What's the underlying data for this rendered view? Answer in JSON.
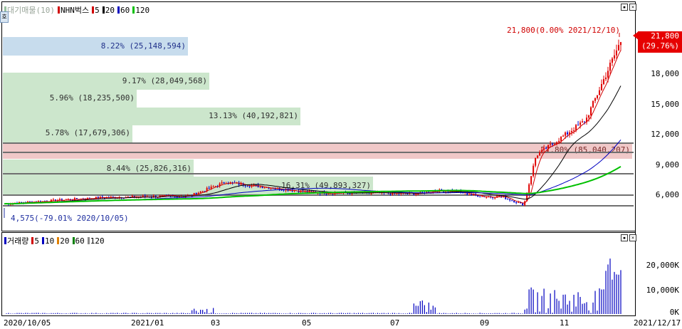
{
  "price_legend": [
    {
      "label": "대기매물(10)",
      "color": "#9bc3a0",
      "dim": true
    },
    {
      "label": "NHN벅스",
      "color": "#d00000"
    },
    {
      "label": "5",
      "color": "#d00000"
    },
    {
      "label": "20",
      "color": "#000000"
    },
    {
      "label": "60",
      "color": "#0000c0"
    },
    {
      "label": "120",
      "color": "#00c000"
    }
  ],
  "volume_legend": [
    {
      "label": "거래량",
      "color": "#0000c0"
    },
    {
      "label": "5",
      "color": "#d00000"
    },
    {
      "label": "10",
      "color": "#0000c0"
    },
    {
      "label": "20",
      "color": "#e08000"
    },
    {
      "label": "60",
      "color": "#008000"
    },
    {
      "label": "120",
      "color": "#888888"
    }
  ],
  "volume_profile": [
    {
      "label": "8.22% (25,148,594)",
      "color": "blue",
      "shade": "blue"
    },
    {
      "label": "9.17% (28,049,568)",
      "color": "green",
      "shade": "green"
    },
    {
      "label": "5.96% (18,235,500)",
      "color": "green",
      "shade": "green"
    },
    {
      "label": "13.13% (40,192,821)",
      "color": "green",
      "shade": "green"
    },
    {
      "label": "5.78% (17,679,306)",
      "color": "green",
      "shade": "green"
    },
    {
      "label": "27.80% (85,040,207)",
      "color": "red",
      "shade": "red"
    },
    {
      "label": "8.44% (25,826,316)",
      "color": "green",
      "shade": "green"
    },
    {
      "label": "16.31% (49,893,327)",
      "color": "green",
      "shade": "green"
    }
  ],
  "price_axis": [
    "18,000",
    "15,000",
    "12,000",
    "9,000",
    "6,000"
  ],
  "volume_axis": [
    "20,000K",
    "10,000K",
    "0K"
  ],
  "x_axis": [
    "2020/10/05",
    "2021/01",
    "03",
    "05",
    "07",
    "09",
    "11",
    "2021/12/17"
  ],
  "current_price": {
    "value": "21,800",
    "change": "(29.76%)"
  },
  "high_note": "21,800(0.00% 2021/12/10)",
  "low_note": "4,575(-79.01% 2020/10/05)",
  "corner_btn": "호"
}
